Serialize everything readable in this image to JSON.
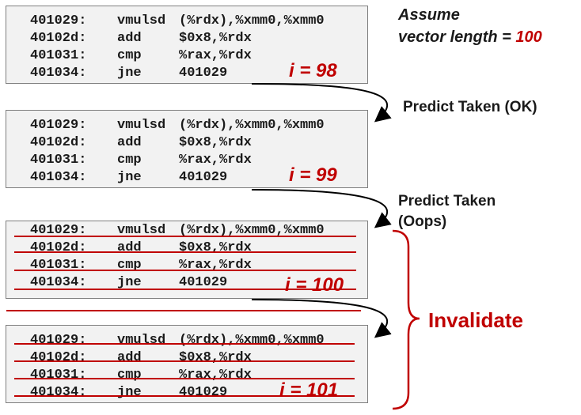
{
  "blocks": [
    {
      "iteration_label": "i = 98",
      "invalidated": false,
      "lines": [
        {
          "addr": "401029:",
          "op": "vmulsd",
          "args": "(%rdx),%xmm0,%xmm0"
        },
        {
          "addr": "40102d:",
          "op": "add",
          "args": "$0x8,%rdx"
        },
        {
          "addr": "401031:",
          "op": "cmp",
          "args": "%rax,%rdx"
        },
        {
          "addr": "401034:",
          "op": "jne",
          "args": "401029"
        }
      ]
    },
    {
      "iteration_label": "i = 99",
      "invalidated": false,
      "lines": [
        {
          "addr": "401029:",
          "op": "vmulsd",
          "args": "(%rdx),%xmm0,%xmm0"
        },
        {
          "addr": "40102d:",
          "op": "add",
          "args": "$0x8,%rdx"
        },
        {
          "addr": "401031:",
          "op": "cmp",
          "args": "%rax,%rdx"
        },
        {
          "addr": "401034:",
          "op": "jne",
          "args": "401029"
        }
      ]
    },
    {
      "iteration_label": "i = 100",
      "invalidated": true,
      "lines": [
        {
          "addr": "401029:",
          "op": "vmulsd",
          "args": "(%rdx),%xmm0,%xmm0"
        },
        {
          "addr": "40102d:",
          "op": "add",
          "args": "$0x8,%rdx"
        },
        {
          "addr": "401031:",
          "op": "cmp",
          "args": "%rax,%rdx"
        },
        {
          "addr": "401034:",
          "op": "jne",
          "args": "401029"
        }
      ]
    },
    {
      "iteration_label": "i = 101",
      "invalidated": true,
      "lines": [
        {
          "addr": "401029:",
          "op": "vmulsd",
          "args": "(%rdx),%xmm0,%xmm0"
        },
        {
          "addr": "40102d:",
          "op": "add",
          "args": "$0x8,%rdx"
        },
        {
          "addr": "401031:",
          "op": "cmp",
          "args": "%rax,%rdx"
        },
        {
          "addr": "401034:",
          "op": "jne",
          "args": "401029"
        }
      ]
    }
  ],
  "assume": {
    "line1": "Assume",
    "line2_prefix": "vector length = ",
    "line2_value": "100"
  },
  "predictions": [
    {
      "line1": "Predict Taken (OK)",
      "line2": ""
    },
    {
      "line1": "Predict Taken",
      "line2": "(Oops)"
    }
  ],
  "invalidate_label": "Invalidate",
  "colors": {
    "accent_red": "#c00000",
    "block_fill": "#f2f2f2",
    "block_border": "#7f7f7f",
    "text": "#1a1a1a"
  }
}
